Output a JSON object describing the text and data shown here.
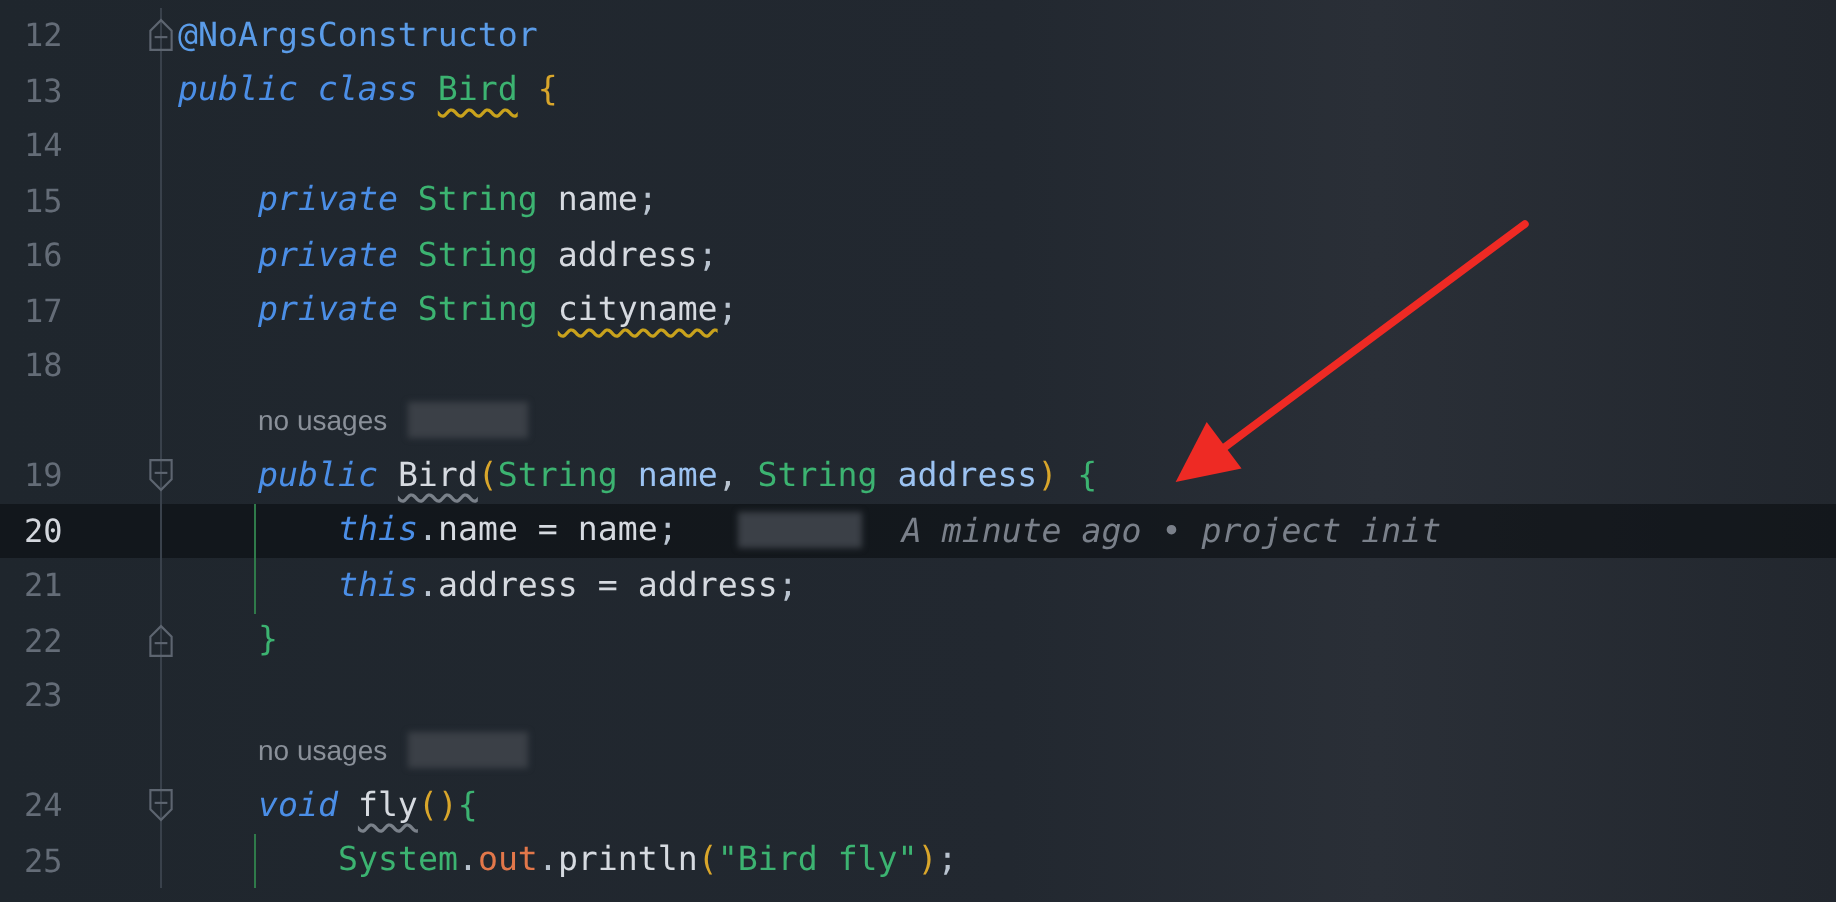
{
  "lines": [
    {
      "kind": "code",
      "number": "12",
      "current": false,
      "fold_end": true,
      "tokens": [
        {
          "kind": "annotation",
          "text": "@NoArgsConstructor"
        }
      ]
    },
    {
      "kind": "code",
      "number": "13",
      "current": false,
      "tokens": [
        {
          "kind": "keyword",
          "text": "public class "
        },
        {
          "kind": "type",
          "text": "Bird",
          "warning": true
        },
        {
          "kind": "bracket",
          "text": " {"
        }
      ],
      "children": [
        {
          "kind": "code",
          "number": "14",
          "current": false
        },
        {
          "kind": "code",
          "number": "15",
          "current": false,
          "tokens": [
            {
              "kind": "keyword",
              "text": "private"
            },
            {
              "kind": "type",
              "text": " String"
            },
            {
              "kind": "ident",
              "text": " name"
            },
            {
              "kind": "punct",
              "text": ";"
            }
          ]
        },
        {
          "kind": "code",
          "number": "16",
          "current": false,
          "tokens": [
            {
              "kind": "keyword",
              "text": "private"
            },
            {
              "kind": "type",
              "text": " String"
            },
            {
              "kind": "ident",
              "text": " address"
            },
            {
              "kind": "punct",
              "text": ";"
            }
          ]
        },
        {
          "kind": "code",
          "number": "17",
          "current": false,
          "tokens": [
            {
              "kind": "keyword",
              "text": "private"
            },
            {
              "kind": "type",
              "text": " String "
            },
            {
              "kind": "ident",
              "text": "cityname",
              "warning": true
            },
            {
              "kind": "punct",
              "text": ";"
            }
          ]
        },
        {
          "kind": "code",
          "number": "18",
          "current": false
        },
        {
          "kind": "inlay",
          "text": "no usages",
          "redacted": true
        },
        {
          "kind": "code",
          "number": "19",
          "current": false,
          "fold_start": true,
          "tokens": [
            {
              "kind": "keyword",
              "text": "public "
            },
            {
              "kind": "ident",
              "text": "Bird",
              "weak_warning": true
            },
            {
              "kind": "paren",
              "text": "("
            },
            {
              "kind": "type",
              "text": "String"
            },
            {
              "kind": "param",
              "text": " name"
            },
            {
              "kind": "punct",
              "text": ","
            },
            {
              "kind": "type",
              "text": " String"
            },
            {
              "kind": "param",
              "text": " address"
            },
            {
              "kind": "paren",
              "text": ")"
            },
            {
              "kind": "brace",
              "text": " {"
            }
          ],
          "children": [
            {
              "kind": "code",
              "number": "20",
              "current": true,
              "guide": true,
              "tokens": [
                {
                  "kind": "keyword",
                  "text": "this"
                },
                {
                  "kind": "punct",
                  "text": "."
                },
                {
                  "kind": "ident",
                  "text": "name = name"
                },
                {
                  "kind": "punct",
                  "text": ";"
                }
              ],
              "blame": {
                "text": "A minute ago • project init",
                "redacted": true
              }
            },
            {
              "kind": "code",
              "number": "21",
              "current": false,
              "guide": true,
              "tokens": [
                {
                  "kind": "keyword",
                  "text": "this"
                },
                {
                  "kind": "punct",
                  "text": "."
                },
                {
                  "kind": "ident",
                  "text": "address = address"
                },
                {
                  "kind": "punct",
                  "text": ";"
                }
              ]
            }
          ]
        },
        {
          "kind": "code",
          "number": "22",
          "current": false,
          "fold_end": true,
          "tokens": [
            {
              "kind": "brace",
              "text": "}"
            }
          ]
        },
        {
          "kind": "code",
          "number": "23",
          "current": false
        },
        {
          "kind": "inlay",
          "text": "no usages",
          "redacted": true
        },
        {
          "kind": "code",
          "number": "24",
          "current": false,
          "fold_start": true,
          "tokens": [
            {
              "kind": "keyword",
              "text": "void "
            },
            {
              "kind": "ident",
              "text": "fly",
              "weak_warning": true
            },
            {
              "kind": "paren",
              "text": "()"
            },
            {
              "kind": "brace",
              "text": "{"
            }
          ],
          "children": [
            {
              "kind": "code",
              "number": "25",
              "current": false,
              "guide": true,
              "tokens": [
                {
                  "kind": "type",
                  "text": "System"
                },
                {
                  "kind": "punct",
                  "text": "."
                },
                {
                  "kind": "field",
                  "text": "out"
                },
                {
                  "kind": "punct",
                  "text": "."
                },
                {
                  "kind": "ident",
                  "text": "println"
                },
                {
                  "kind": "paren",
                  "text": "("
                },
                {
                  "kind": "string",
                  "text": "\"Bird fly\""
                },
                {
                  "kind": "paren",
                  "text": ")"
                },
                {
                  "kind": "punct",
                  "text": ";"
                }
              ]
            }
          ]
        }
      ]
    }
  ]
}
